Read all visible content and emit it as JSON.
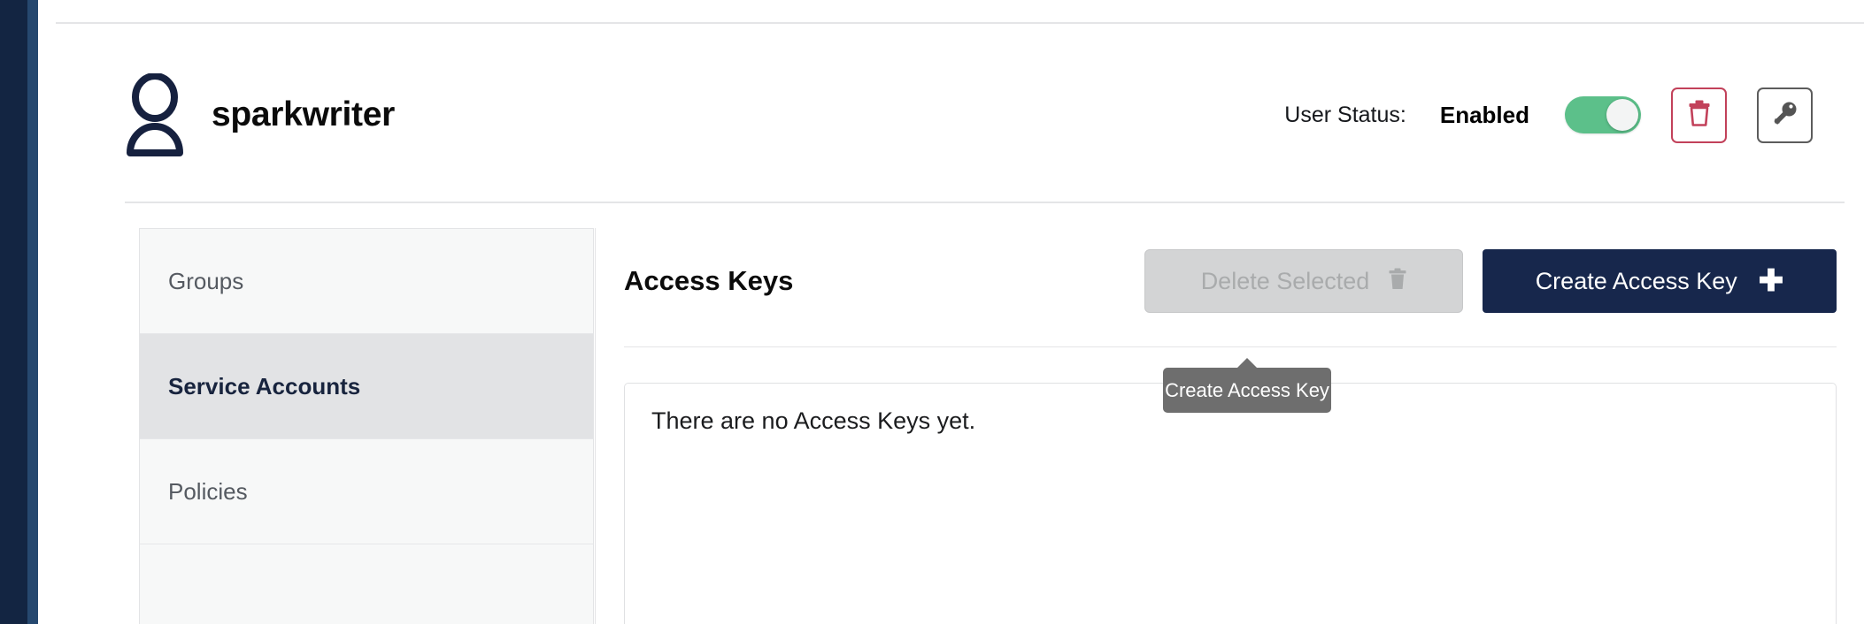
{
  "rail": {
    "dark_color": "#132542",
    "accent_color": "#26486f"
  },
  "user_header": {
    "avatar_icon": "person-icon",
    "username": "sparkwriter",
    "status_label": "User Status:",
    "status_value": "Enabled",
    "toggle_on": true,
    "toggle_on_color": "#5cc08a",
    "delete_icon": "trash-icon",
    "delete_border_color": "#c2415a",
    "password_icon": "key-icon",
    "password_border_color": "#5c5c5c"
  },
  "tabs": [
    {
      "label": "Groups",
      "active": false
    },
    {
      "label": "Service Accounts",
      "active": true
    },
    {
      "label": "Policies",
      "active": false
    }
  ],
  "panel": {
    "title": "Access Keys",
    "delete_selected_label": "Delete Selected",
    "delete_selected_icon": "trash-icon",
    "delete_selected_disabled": true,
    "create_key_label": "Create Access Key",
    "create_key_icon": "plus-icon",
    "create_key_color": "#17274c",
    "empty_state_text": "There are no Access Keys yet."
  },
  "tooltip": {
    "label": "Create Access Key",
    "background": "#6e6e6e"
  }
}
